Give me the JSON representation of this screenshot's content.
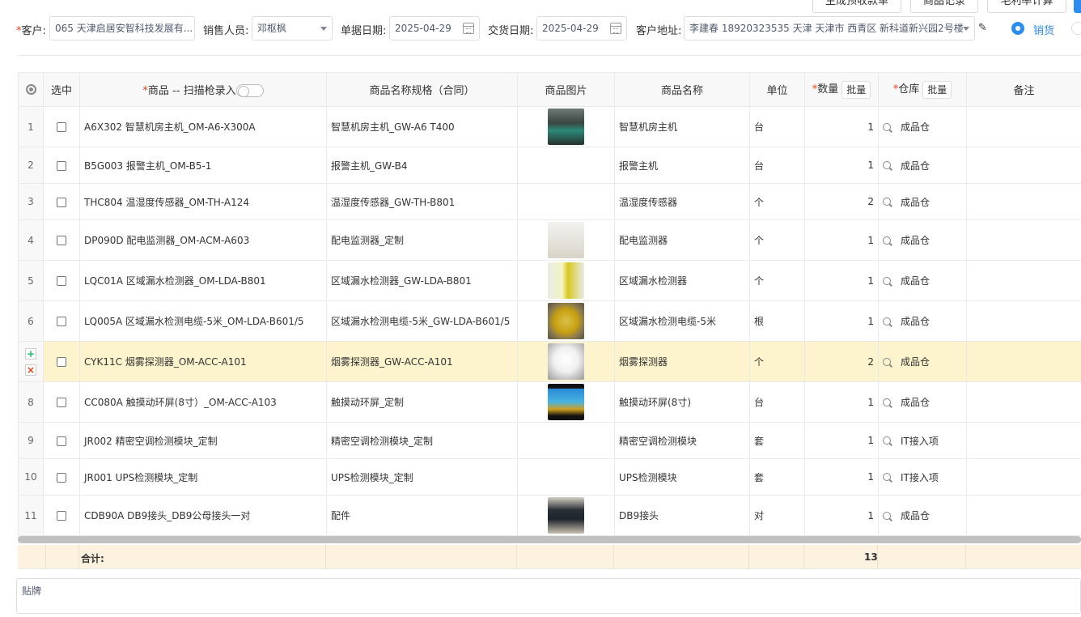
{
  "toolbar": {
    "btn1": "生成预收款单",
    "btn2": "商品记录",
    "btn3": "毛利率计算"
  },
  "form": {
    "customer_label": "客户:",
    "customer_value": "065 天津启居安智科技发展有...",
    "sales_label": "销售人员:",
    "sales_value": "邓枢枫",
    "doc_date_label": "单据日期:",
    "doc_date_value": "2025-04-29",
    "delivery_date_label": "交货日期:",
    "delivery_date_value": "2025-04-29",
    "address_label": "客户地址:",
    "address_value": "李建春 18920323535 天津 天津市 西青区 新科道新兴园2号楼",
    "mode_label": "销货"
  },
  "table": {
    "headers": {
      "select": "选中",
      "product": "商品 -- 扫描枪录入",
      "spec": "商品名称规格（合同）",
      "image": "商品图片",
      "name": "商品名称",
      "unit": "单位",
      "qty": "数量",
      "warehouse": "仓库",
      "remark": "备注",
      "batch": "批量"
    },
    "rows": [
      {
        "no": "1",
        "product": "A6X302 智慧机房主机_OM-A6-X300A",
        "spec": "智慧机房主机_GW-A6 T400",
        "name": "智慧机房主机",
        "unit": "台",
        "qty": "1",
        "warehouse": "成品仓"
      },
      {
        "no": "2",
        "product": "B5G003 报警主机_OM-B5-1",
        "spec": "报警主机_GW-B4",
        "name": "报警主机",
        "unit": "台",
        "qty": "1",
        "warehouse": "成品仓"
      },
      {
        "no": "3",
        "product": "THC804 温湿度传感器_OM-TH-A124",
        "spec": "温湿度传感器_GW-TH-B801",
        "name": "温湿度传感器",
        "unit": "个",
        "qty": "2",
        "warehouse": "成品仓"
      },
      {
        "no": "4",
        "product": "DP090D 配电监测器_OM-ACM-A603",
        "spec": "配电监测器_定制",
        "name": "配电监测器",
        "unit": "个",
        "qty": "1",
        "warehouse": "成品仓"
      },
      {
        "no": "5",
        "product": "LQC01A 区域漏水检测器_OM-LDA-B801",
        "spec": "区域漏水检测器_GW-LDA-B801",
        "name": "区域漏水检测器",
        "unit": "个",
        "qty": "1",
        "warehouse": "成品仓"
      },
      {
        "no": "6",
        "product": "LQ005A 区域漏水检测电缆-5米_OM-LDA-B601/5",
        "spec": "区域漏水检测电缆-5米_GW-LDA-B601/5",
        "name": "区域漏水检测电缆-5米",
        "unit": "根",
        "qty": "1",
        "warehouse": "成品仓"
      },
      {
        "no": "",
        "product": "CYK11C 烟雾探测器_OM-ACC-A101",
        "spec": "烟雾探测器_GW-ACC-A101",
        "name": "烟雾探测器",
        "unit": "个",
        "qty": "2",
        "warehouse": "成品仓"
      },
      {
        "no": "8",
        "product": "CC080A 触摸动环屏(8寸）_OM-ACC-A103",
        "spec": "触摸动环屏_定制",
        "name": "触摸动环屏(8寸)",
        "unit": "台",
        "qty": "1",
        "warehouse": "成品仓"
      },
      {
        "no": "9",
        "product": "JR002 精密空调检测模块_定制",
        "spec": "精密空调检测模块_定制",
        "name": "精密空调检测模块",
        "unit": "套",
        "qty": "1",
        "warehouse": "IT接入项"
      },
      {
        "no": "10",
        "product": "JR001 UPS检测模块_定制",
        "spec": "UPS检测模块_定制",
        "name": "UPS检测模块",
        "unit": "套",
        "qty": "1",
        "warehouse": "IT接入项"
      },
      {
        "no": "11",
        "product": "CDB90A DB9接头_DB9公母接头一对",
        "spec": "配件",
        "name": "DB9接头",
        "unit": "对",
        "qty": "1",
        "warehouse": "成品仓"
      }
    ],
    "total_label": "合计:",
    "total_qty": "13"
  },
  "remark": {
    "value": "贴牌"
  },
  "colors": {
    "accent": "#2d8cf0",
    "required": "#ed4014",
    "highlight_row": "#fdf3cc",
    "total_row": "#fdf2e0"
  }
}
